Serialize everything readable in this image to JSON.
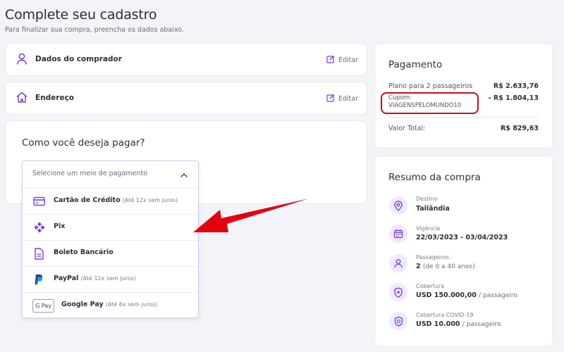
{
  "page": {
    "title": "Complete seu cadastro",
    "subtitle": "Para finalizar sua compra, preencha os dados abaixo."
  },
  "sections": {
    "buyer": {
      "label": "Dados do comprador",
      "edit": "Editar",
      "icon": "person-icon"
    },
    "address": {
      "label": "Endereço",
      "edit": "Editar",
      "icon": "home-icon"
    },
    "payment_method": {
      "heading": "Como você deseja pagar?",
      "select_placeholder": "Selecione um meio de pagamento",
      "options": [
        {
          "label": "Cartão de Crédito",
          "note": "(Até 12x sem juros)",
          "icon": "credit-card-icon"
        },
        {
          "label": "Pix",
          "note": "",
          "icon": "pix-icon"
        },
        {
          "label": "Boleto Bancário",
          "note": "",
          "icon": "document-icon"
        },
        {
          "label": "PayPal",
          "note": "(Até 12x sem juros)",
          "icon": "paypal-icon"
        },
        {
          "label": "Google Pay",
          "note": "(Até 6x sem juros)",
          "icon": "google-pay-icon",
          "badge": "G Pay"
        }
      ]
    }
  },
  "payment": {
    "heading": "Pagamento",
    "plan_label": "Plano para 2 passageiros",
    "plan_value": "R$ 2.633,76",
    "coupon_label": "Cupom:",
    "coupon_code": "VIAGENSPELOMUNDO10",
    "coupon_value": "- R$ 1.804,13",
    "total_label": "Valor Total:",
    "total_value": "R$ 829,63"
  },
  "summary": {
    "heading": "Resumo da compra",
    "items": [
      {
        "label": "Destino",
        "value": "Tailândia",
        "suffix": "",
        "icon": "location-pin-icon"
      },
      {
        "label": "Vigência",
        "value": "22/03/2023 - 03/04/2023",
        "suffix": "",
        "icon": "calendar-icon"
      },
      {
        "label": "Passageiros",
        "value": "2",
        "suffix": "(de 0 a 40 anos)",
        "icon": "person-icon"
      },
      {
        "label": "Cobertura",
        "value": "USD 150.000,00",
        "suffix": "/ passageiro",
        "icon": "shield-icon"
      },
      {
        "label": "Cobertura COVID-19",
        "value": "USD 10.000",
        "suffix": "/ passageiro",
        "icon": "virus-shield-icon"
      }
    ]
  },
  "colors": {
    "accent": "#7c3aed",
    "annotation_red": "#e3000f",
    "coupon_highlight": "#c0101a"
  }
}
